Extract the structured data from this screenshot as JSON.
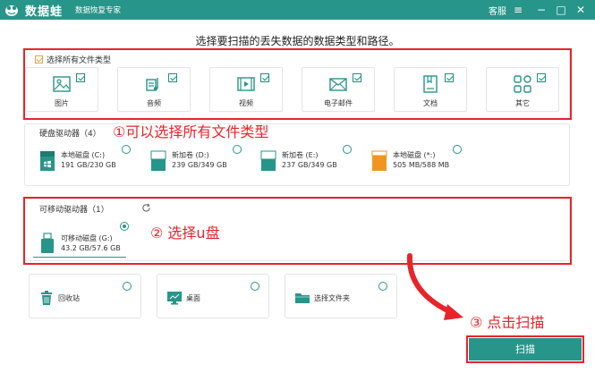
{
  "app": {
    "title": "数据蛙",
    "subtitle": "数据恢复专家",
    "service": "客服"
  },
  "window_buttons": {
    "menu": "≡",
    "minimize": "−",
    "restore": "□",
    "close": "✕"
  },
  "headline": "选择要扫描的丢失数据的数据类型和路径。",
  "file_types": {
    "select_all_label": "选择所有文件类型",
    "items": [
      {
        "label": "图片",
        "icon": "image-icon"
      },
      {
        "label": "音频",
        "icon": "audio-icon"
      },
      {
        "label": "视频",
        "icon": "video-icon"
      },
      {
        "label": "电子邮件",
        "icon": "email-icon"
      },
      {
        "label": "文档",
        "icon": "document-icon"
      },
      {
        "label": "其它",
        "icon": "other-icon"
      }
    ]
  },
  "hard_drives": {
    "label": "硬盘驱动器（4）",
    "items": [
      {
        "name": "本地磁盘 (C:)",
        "size": "191 GB/230 GB",
        "used_fraction": 0.83,
        "color": "#27958a"
      },
      {
        "name": "新加卷 (D:)",
        "size": "239 GB/349 GB",
        "used_fraction": 0.68,
        "color": "#27958a"
      },
      {
        "name": "新加卷 (E:)",
        "size": "237 GB/349 GB",
        "used_fraction": 0.68,
        "color": "#27958a"
      },
      {
        "name": "本地磁盘 (*:)",
        "size": "505 MB/588 MB",
        "used_fraction": 0.86,
        "color": "#f0961e"
      }
    ]
  },
  "removable_drives": {
    "label": "可移动驱动器（1）",
    "items": [
      {
        "name": "可移动磁盘 (G:)",
        "size": "43.2 GB/57.6 GB",
        "used_fraction": 0.75,
        "selected": true
      }
    ]
  },
  "locations": [
    {
      "label": "回收站",
      "icon": "recycle-bin-icon"
    },
    {
      "label": "桌面",
      "icon": "desktop-icon"
    },
    {
      "label": "选择文件夹",
      "icon": "folder-icon"
    }
  ],
  "annotations": {
    "step1": "①可以选择所有文件类型",
    "step2": "② 选择u盘",
    "step3": "③ 点击扫描"
  },
  "scan_button": "扫描",
  "colors": {
    "accent": "#27958a",
    "annotation": "#e8242a",
    "orange": "#f0961e"
  }
}
